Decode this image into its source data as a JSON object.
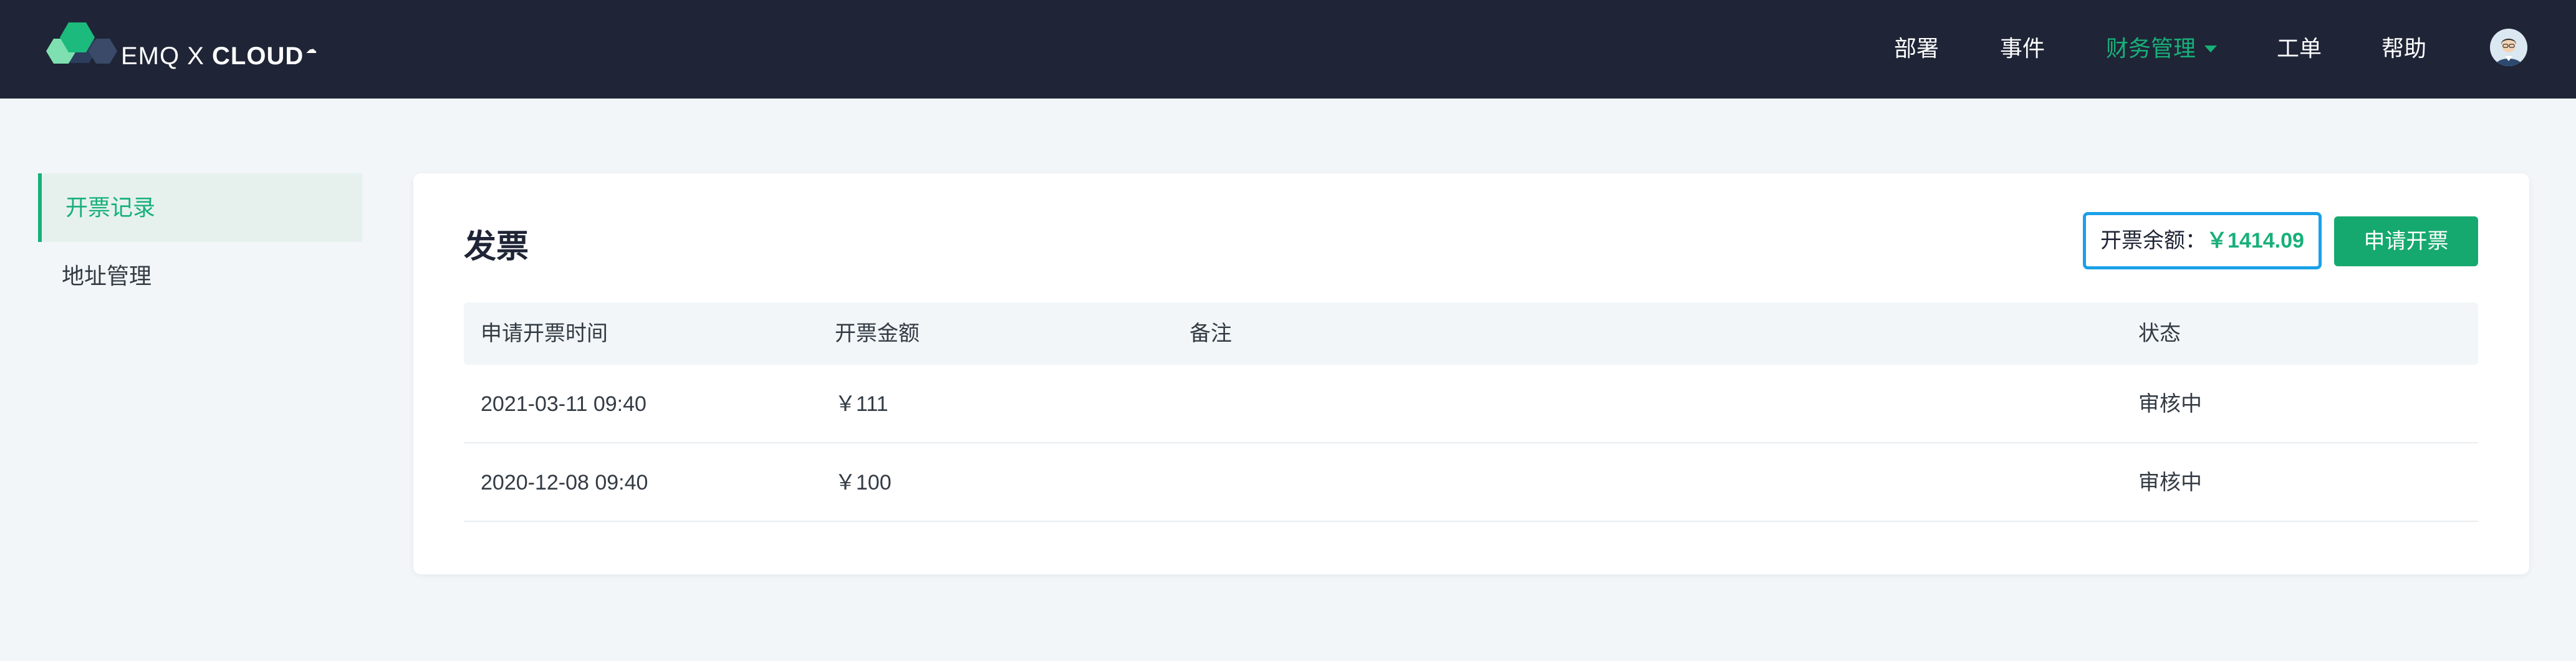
{
  "brand": {
    "prefix": "EMQ X ",
    "name": "CLOUD"
  },
  "nav": {
    "items": [
      {
        "label": "部署"
      },
      {
        "label": "事件"
      },
      {
        "label": "财务管理"
      },
      {
        "label": "工单"
      },
      {
        "label": "帮助"
      }
    ],
    "active": "财务管理"
  },
  "sidebar": {
    "items": [
      {
        "label": "开票记录"
      },
      {
        "label": "地址管理"
      }
    ],
    "active": "开票记录"
  },
  "invoice": {
    "title": "发票",
    "balance_label": "开票余额：",
    "balance_amount": "￥1414.09",
    "apply_label": "申请开票",
    "columns": [
      "申请开票时间",
      "开票金额",
      "备注",
      "状态"
    ],
    "rows": [
      {
        "time": "2021-03-11 09:40",
        "amount": "￥111",
        "note": "",
        "status": "审核中"
      },
      {
        "time": "2020-12-08 09:40",
        "amount": "￥100",
        "note": "",
        "status": "审核中"
      }
    ]
  },
  "colors": {
    "header_bg": "#1f2536",
    "accent": "#18b07a",
    "page_bg": "#f2f6f8",
    "balance_border": "#1aa0e8"
  }
}
